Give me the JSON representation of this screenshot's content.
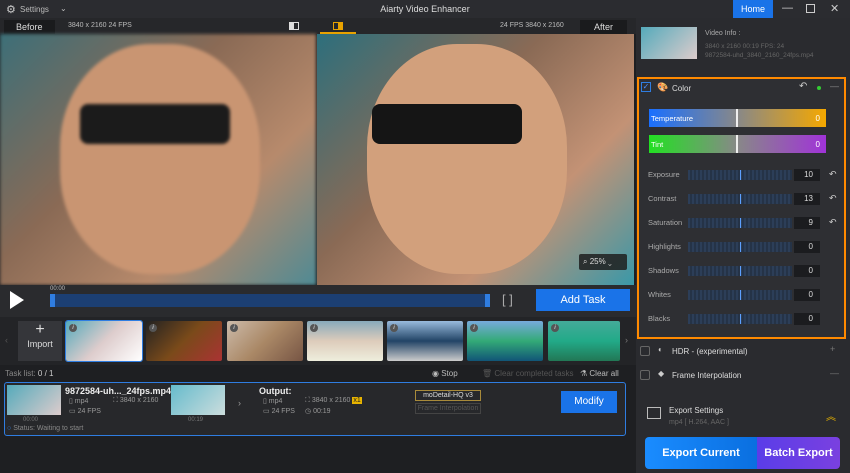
{
  "title": {
    "settings": "Settings",
    "app": "Aiarty Video Enhancer",
    "home": "Home"
  },
  "compare": {
    "before": "Before",
    "before_info": "3840 x 2160  24 FPS",
    "after": "After",
    "after_info": "24 FPS  3840 x 2160",
    "zoom": "25%"
  },
  "timeline": {
    "time": "00:00",
    "add_task": "Add Task",
    "progress": 0.0
  },
  "strip": {
    "import": "Import"
  },
  "tasklist": {
    "label": "Task list:",
    "count": "0 / 1",
    "stop": "Stop",
    "clear_completed": "Clear completed tasks",
    "clear_all": "Clear all"
  },
  "task": {
    "filename": "9872584-uh..._24fps.mp4",
    "format": "mp4",
    "resolution": "3840 x 2160",
    "fps": "24 FPS",
    "start": "00:00",
    "end": "00:19",
    "output_label": "Output:",
    "out_format": "mp4",
    "out_resolution": "3840 x 2160",
    "scale": "x1",
    "out_fps": "24 FPS",
    "out_duration": "00:19",
    "model": "moDetail-HQ  v3",
    "frame_interp": "Frame Interpolation",
    "modify": "Modify",
    "status": "Status: Waiting to start"
  },
  "video_info": {
    "title": "Video Info :",
    "meta": "3840 x 2160  00:19    FPS: 24",
    "file": "9872584-uhd_3840_2160_24fps.mp4"
  },
  "color": {
    "title": "Color",
    "temperature": {
      "label": "Temperature",
      "value": "0"
    },
    "tint": {
      "label": "Tint",
      "value": "0"
    },
    "sliders": [
      {
        "label": "Exposure",
        "value": "10"
      },
      {
        "label": "Contrast",
        "value": "13"
      },
      {
        "label": "Saturation",
        "value": "9"
      },
      {
        "label": "Highlights",
        "value": "0"
      },
      {
        "label": "Shadows",
        "value": "0"
      },
      {
        "label": "Whites",
        "value": "0"
      },
      {
        "label": "Blacks",
        "value": "0"
      }
    ]
  },
  "hdr": "HDR - (experimental)",
  "frame_interpolation": "Frame Interpolation",
  "export": {
    "title": "Export Settings",
    "sub": "mp4 [ H.264, AAC ]",
    "current": "Export Current",
    "batch": "Batch Export"
  },
  "colors": {
    "accent": "#1a73e8",
    "highlight": "#ff8a00"
  }
}
